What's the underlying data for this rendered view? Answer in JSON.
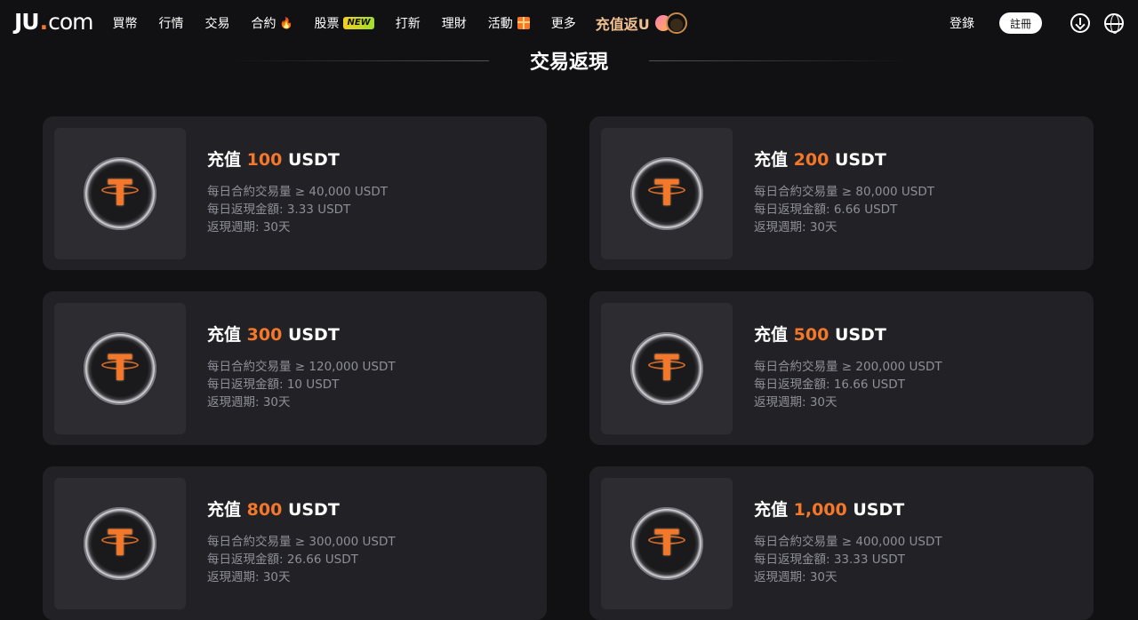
{
  "header": {
    "logo": {
      "ju": "JU",
      "dot": ".",
      "com": "com"
    },
    "nav": [
      {
        "label": "買幣"
      },
      {
        "label": "行情"
      },
      {
        "label": "交易"
      },
      {
        "label": "合約",
        "extra": "🔥"
      },
      {
        "label": "股票",
        "badge": "NEW"
      },
      {
        "label": "打新"
      },
      {
        "label": "理財"
      },
      {
        "label": "活動"
      },
      {
        "label": "更多"
      }
    ],
    "promo": "充值返U",
    "login": "登錄",
    "register": "註冊"
  },
  "section": {
    "title": "交易返現"
  },
  "cards": [
    {
      "prefix": "充值",
      "amount": "100",
      "unit": "USDT",
      "volume": "每日合約交易量 ≥ 40,000 USDT",
      "rebate": "每日返現金額: 3.33 USDT",
      "period": "返現週期: 30天"
    },
    {
      "prefix": "充值",
      "amount": "200",
      "unit": "USDT",
      "volume": "每日合約交易量 ≥ 80,000 USDT",
      "rebate": "每日返現金額: 6.66 USDT",
      "period": "返現週期: 30天"
    },
    {
      "prefix": "充值",
      "amount": "300",
      "unit": "USDT",
      "volume": "每日合約交易量 ≥ 120,000 USDT",
      "rebate": "每日返現金額: 10 USDT",
      "period": "返現週期: 30天"
    },
    {
      "prefix": "充值",
      "amount": "500",
      "unit": "USDT",
      "volume": "每日合約交易量 ≥ 200,000 USDT",
      "rebate": "每日返現金額: 16.66 USDT",
      "period": "返現週期: 30天"
    },
    {
      "prefix": "充值",
      "amount": "800",
      "unit": "USDT",
      "volume": "每日合約交易量 ≥ 300,000 USDT",
      "rebate": "每日返現金額: 26.66 USDT",
      "period": "返現週期: 30天"
    },
    {
      "prefix": "充值",
      "amount": "1,000",
      "unit": "USDT",
      "volume": "每日合約交易量 ≥ 400,000 USDT",
      "rebate": "每日返現金額: 33.33 USDT",
      "period": "返現週期: 30天"
    }
  ],
  "colors": {
    "accent": "#f5782a",
    "background": "#111113",
    "card": "#222226",
    "muted": "#8e8e96"
  },
  "icons": {
    "coin": "tether-usdt-icon",
    "download": "download-icon",
    "language": "globe-icon",
    "fire": "fire-icon",
    "gift": "gift-icon"
  }
}
